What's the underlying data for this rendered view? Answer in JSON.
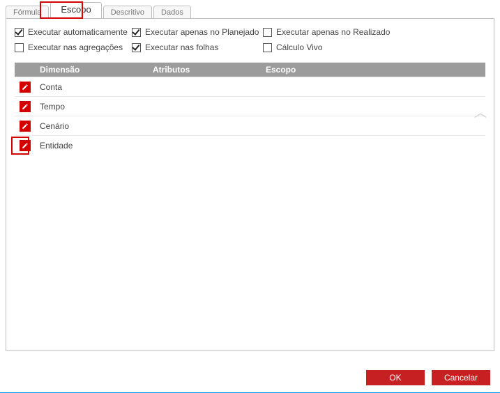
{
  "tabs": {
    "formula": "Fórmula",
    "escopo": "Escopo",
    "descritivo": "Descritivo",
    "dados": "Dados"
  },
  "checks": {
    "exec_auto": {
      "label": "Executar automaticamente",
      "checked": true
    },
    "exec_planejado": {
      "label": "Executar apenas no Planejado",
      "checked": true
    },
    "exec_realizado": {
      "label": "Executar apenas no Realizado",
      "checked": false
    },
    "exec_agregacoes": {
      "label": "Executar nas agregações",
      "checked": false
    },
    "exec_folhas": {
      "label": "Executar nas folhas",
      "checked": true
    },
    "calc_vivo": {
      "label": "Cálculo Vivo",
      "checked": false
    }
  },
  "grid": {
    "headers": {
      "dimensao": "Dimensão",
      "atributos": "Atributos",
      "escopo": "Escopo"
    },
    "rows": [
      {
        "dimensao": "Conta",
        "atributos": "",
        "escopo": ""
      },
      {
        "dimensao": "Tempo",
        "atributos": "",
        "escopo": ""
      },
      {
        "dimensao": "Cenário",
        "atributos": "",
        "escopo": ""
      },
      {
        "dimensao": "Entidade",
        "atributos": "",
        "escopo": ""
      }
    ]
  },
  "buttons": {
    "ok": "OK",
    "cancel": "Cancelar"
  }
}
